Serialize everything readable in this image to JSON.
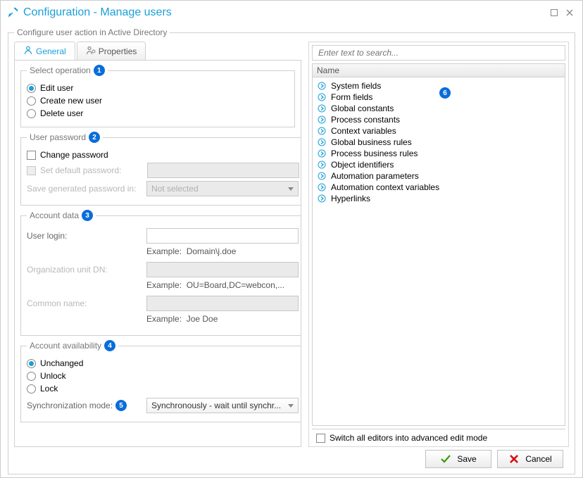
{
  "window": {
    "title": "Configuration - Manage users",
    "fieldset_title": "Configure user action in Active Directory"
  },
  "tabs": {
    "general": "General",
    "properties": "Properties"
  },
  "groups": {
    "select_op": "Select operation",
    "user_pwd": "User password",
    "account_data": "Account data",
    "account_avail": "Account availability"
  },
  "ops": {
    "edit": "Edit user",
    "create": "Create new user",
    "del": "Delete user"
  },
  "pwd": {
    "change": "Change password",
    "set_default": "Set default password:",
    "save_in": "Save generated password in:",
    "not_selected": "Not selected"
  },
  "acct": {
    "login_label": "User login:",
    "login_example_lbl": "Example:",
    "login_example": "Domain\\j.doe",
    "org_label": "Organization unit DN:",
    "org_example": "OU=Board,DC=webcon,...",
    "cn_label": "Common name:",
    "cn_example": "Joe Doe"
  },
  "avail": {
    "unchanged": "Unchanged",
    "unlock": "Unlock",
    "lock": "Lock"
  },
  "sync": {
    "label": "Synchronization mode:",
    "value": "Synchronously - wait until synchr..."
  },
  "search": {
    "placeholder": "Enter text to search...",
    "column": "Name"
  },
  "tree": [
    {
      "label": "System fields",
      "exp": true
    },
    {
      "label": "Form fields",
      "exp": true
    },
    {
      "label": "Global constants",
      "exp": true
    },
    {
      "label": "Process constants",
      "exp": false
    },
    {
      "label": "Context variables",
      "exp": true
    },
    {
      "label": "Global business rules",
      "exp": true
    },
    {
      "label": "Process business rules",
      "exp": true
    },
    {
      "label": "Object identifiers",
      "exp": true
    },
    {
      "label": "Automation parameters",
      "exp": true
    },
    {
      "label": "Automation context variables",
      "exp": true
    },
    {
      "label": "Hyperlinks",
      "exp": true
    }
  ],
  "advanced": "Switch all editors into advanced edit mode",
  "buttons": {
    "save": "Save",
    "cancel": "Cancel"
  },
  "badges": {
    "b1": "1",
    "b2": "2",
    "b3": "3",
    "b4": "4",
    "b5": "5",
    "b6": "6"
  }
}
